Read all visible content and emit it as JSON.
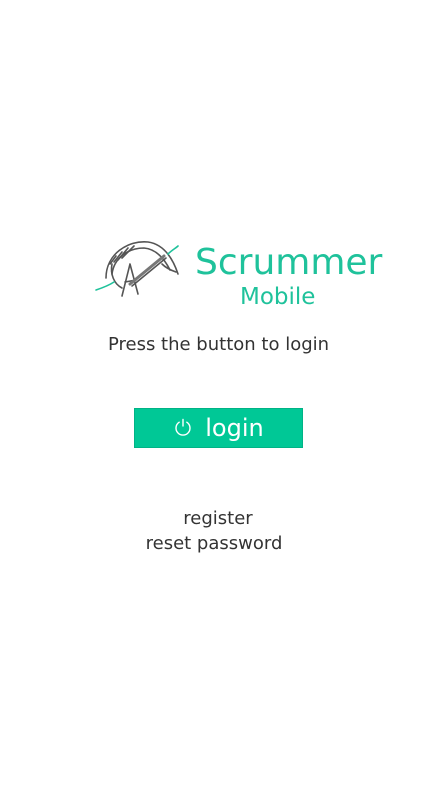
{
  "brand": {
    "title": "Scrummer",
    "subtitle": "Mobile",
    "accent_color": "#1fc29b",
    "logo_icon": "scrummer-logo-icon"
  },
  "login": {
    "prompt": "Press the button to login",
    "button_label": "login",
    "button_icon": "power-icon",
    "button_color": "#00c896"
  },
  "links": {
    "register": "register",
    "reset_password": "reset password"
  }
}
